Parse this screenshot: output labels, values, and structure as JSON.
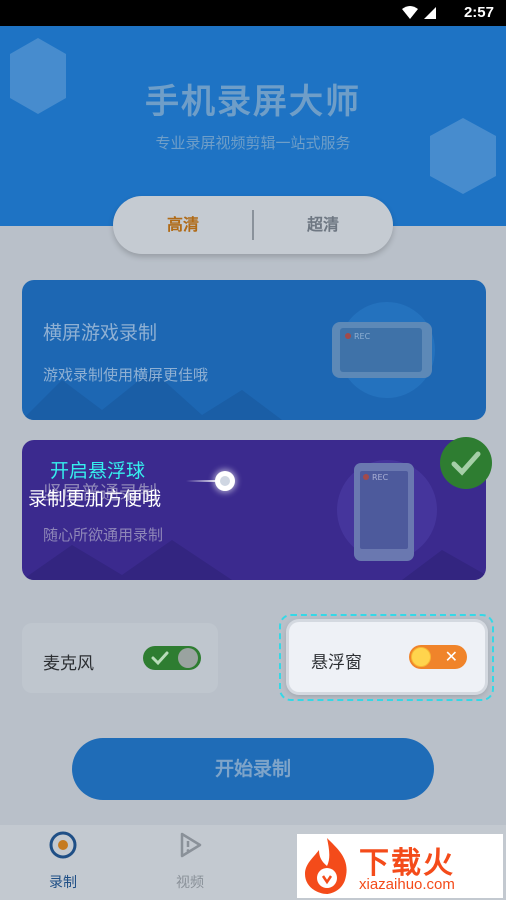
{
  "status": {
    "time": "2:57",
    "icons": [
      "wifi-icon",
      "signal-icon",
      "battery-icon"
    ]
  },
  "header": {
    "title": "手机录屏大师",
    "subtitle": "专业录屏视频剪辑一站式服务"
  },
  "quality": {
    "options": [
      "高清",
      "超清"
    ],
    "selected": "高清"
  },
  "cards": [
    {
      "title": "横屏游戏录制",
      "desc": "游戏录制使用横屏更佳哦",
      "icon": "tablet-rec-icon",
      "rec_label": "REC"
    },
    {
      "title": "竖屏普通录制",
      "desc": "随心所欲通用录制",
      "icon": "phone-rec-icon",
      "rec_label": "REC",
      "selected": true
    }
  ],
  "toggles": {
    "mic": {
      "label": "麦克风",
      "state": "on"
    },
    "float_window": {
      "label": "悬浮窗",
      "state": "off"
    }
  },
  "tooltip": {
    "line1": "开启悬浮球",
    "line2": "录制更加方便哦"
  },
  "start_button": {
    "label": "开始录制"
  },
  "nav": [
    {
      "label": "录制",
      "icon": "record-icon",
      "active": true
    },
    {
      "label": "视频",
      "icon": "video-icon",
      "active": false
    }
  ],
  "watermark": {
    "text": "下载火",
    "url": "xiazaihuo.com"
  },
  "colors": {
    "accent": "#1e73c4",
    "orange": "#f0842a",
    "green": "#2e7d31",
    "highlight": "#35d8e6"
  }
}
